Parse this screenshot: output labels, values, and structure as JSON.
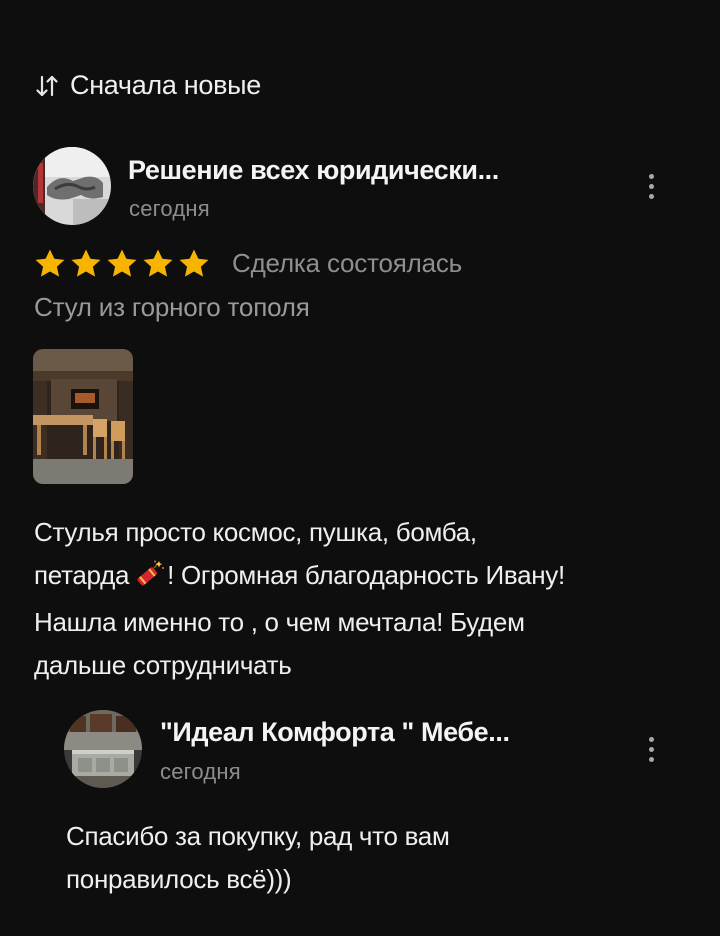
{
  "sort": {
    "label": "Сначала новые",
    "icon": "sort-arrows-icon"
  },
  "review": {
    "author": "Решение всех юридически...",
    "date": "сегодня",
    "rating": 5,
    "rating_max": 5,
    "star_color": "#f6b400",
    "deal_status": "Сделка состоялась",
    "product": "Стул из горного тополя",
    "text_lines": [
      "Стулья просто космос, пушка, бомба,",
      "петарда",
      "! Огромная благодарность Ивану!",
      "Нашла именно то , о чем мечтала! Будем",
      "дальше сотрудничать"
    ]
  },
  "reply": {
    "author": "\"Идеал Комфорта \" Мебе...",
    "date": "сегодня",
    "text_lines": [
      "Спасибо за покупку, рад что вам",
      "понравилось всё)))"
    ]
  }
}
